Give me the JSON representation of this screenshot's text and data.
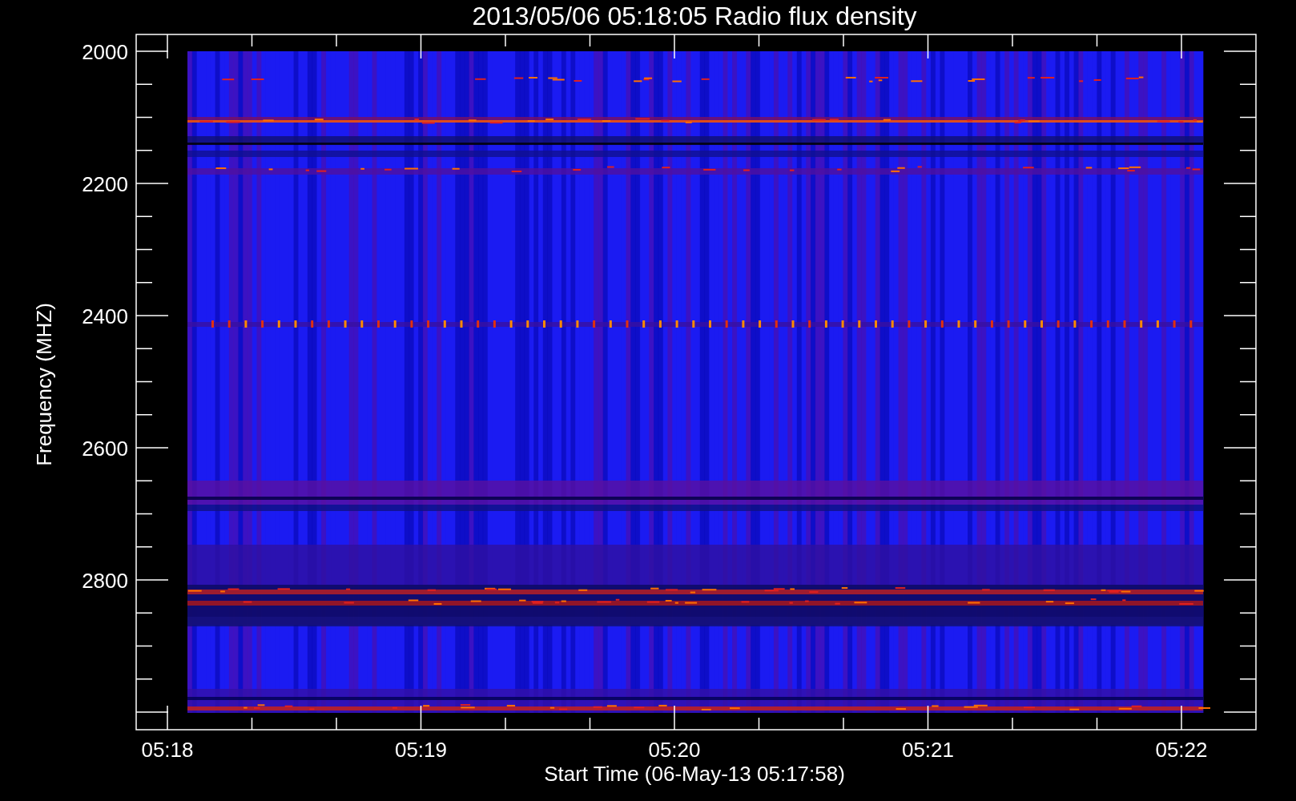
{
  "title": "2013/05/06 05:18:05 Radio flux density",
  "y_axis": {
    "label": "Frequency (MHZ)",
    "ticks": [
      "2000",
      "2200",
      "2400",
      "2600",
      "2800"
    ]
  },
  "x_axis": {
    "label": "Start Time (06-May-13 05:17:58)",
    "ticks": [
      "05:18",
      "05:19",
      "05:20",
      "05:21",
      "05:22"
    ]
  }
}
